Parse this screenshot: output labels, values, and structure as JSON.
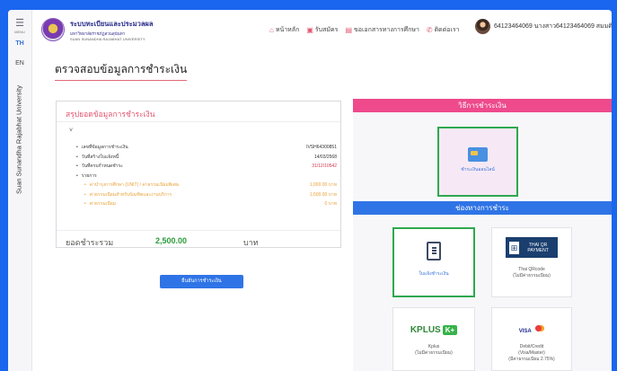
{
  "left_rail": {
    "menu_icon": "hamburger-icon",
    "menu_label": "MENU",
    "languages": [
      "TH",
      "EN"
    ],
    "vertical_text": "Suan Sunandha Rajabhat University"
  },
  "header": {
    "system_name": "ระบบทะเบียนและประมวลผล",
    "university_th": "มหาวิทยาลัยราชภัฏสวนสุนันทา",
    "university_en": "SUAN SUNANDHA RAJABHAT UNIVERSITY",
    "nav": [
      {
        "label": "หน้าหลัก",
        "icon": "home-icon"
      },
      {
        "label": "รับสมัคร",
        "icon": "form-icon"
      },
      {
        "label": "ขอเอกสารทางการศึกษา",
        "icon": "document-icon"
      },
      {
        "label": "ติดต่อเรา",
        "icon": "phone-icon"
      }
    ],
    "user": {
      "avatar_icon": "avatar-icon",
      "text": "64123464069 นางสาว64123464069 สมมติ Y"
    }
  },
  "page_title": "ตรวจสอบข้อมูลการชำระเงิน",
  "summary": {
    "title": "สรุปยอดข้อมูลการชำระเงิน",
    "chevron": "˅",
    "rows": [
      {
        "label": "เลขที่ข้อมูลการชำระเงิน",
        "value": "IVSH64300851"
      },
      {
        "label": "วันที่สร้างใบแจ้งหนี้",
        "value": "14/03/2568"
      },
      {
        "label": "วันที่ครบกำหนดชำระ",
        "value": "31/12/10542"
      }
    ],
    "items_label": "รายการ",
    "items": [
      {
        "label": "ค่าบำรุงการศึกษา (UNIT) / ค่าธรรมเนียมพิเศษ",
        "value": "1,000.00 บาท"
      },
      {
        "label": "ค่าธรรมเนียมสำหรับบัณฑิตและงานบริการ",
        "value": "1,500.00 บาท"
      },
      {
        "label": "ค่าธรรมเนียม",
        "value": "0 บาท"
      }
    ],
    "total_label": "ยอดชำระรวม",
    "total_amount": "2,500.00",
    "currency": "บาท"
  },
  "submit_button": "ยืนยันการชำระเงิน",
  "payment_method": {
    "title": "วิธีการชำระเงิน",
    "option": {
      "label": "ชำระเงินออนไลน์",
      "icon": "credit-card-icon"
    }
  },
  "payment_channels": {
    "title": "ช่องทางการชำระ",
    "options": [
      {
        "label": "ใบแจ้งชำระเงิน",
        "icon": "invoice-icon"
      },
      {
        "logo": "THAI QR PAYMENT",
        "name": "Thai QRcode",
        "note": "(ไม่มีค่าธรรมเนียม)"
      },
      {
        "logo": "KPLUS",
        "name": "Kplus",
        "note": "(ไม่มีค่าธรรมเนียม)"
      },
      {
        "logo": "VISA",
        "name": "Debit/Credit",
        "name2": "(Visa/Master)",
        "note": "(มีค่าธรรมเนียม 2.75%)"
      }
    ]
  },
  "colors": {
    "background": "#1a66ee",
    "accent_pink": "#ee4a8c",
    "accent_blue": "#2f74e6",
    "total_green": "#2a9d3a",
    "due_red": "#d4364d",
    "item_orange": "#e8a23a",
    "selected_border": "#2fa84f"
  }
}
